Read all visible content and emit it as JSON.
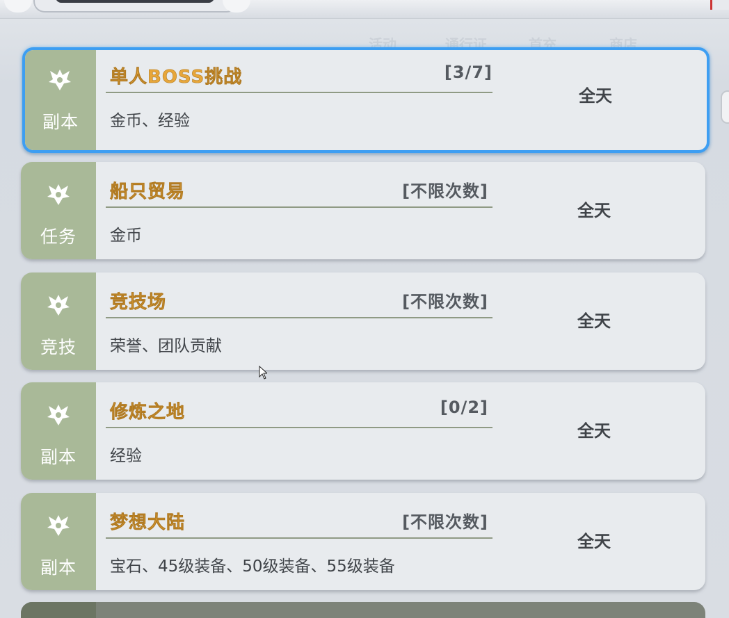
{
  "background_tabs": [
    "活动",
    "通行证",
    "首充",
    "商店"
  ],
  "activities": [
    {
      "category": "副本",
      "title": "单人BOSS挑战",
      "count": "[3/7]",
      "rewards": "金币、经验",
      "time": "全天",
      "selected": true
    },
    {
      "category": "任务",
      "title": "船只贸易",
      "count": "[不限次数]",
      "rewards": "金币",
      "time": "全天",
      "selected": false
    },
    {
      "category": "竞技",
      "title": "竞技场",
      "count": "[不限次数]",
      "rewards": "荣誉、团队贡献",
      "time": "全天",
      "selected": false
    },
    {
      "category": "副本",
      "title": "修炼之地",
      "count": "[0/2]",
      "rewards": "经验",
      "time": "全天",
      "selected": false
    },
    {
      "category": "副本",
      "title": "梦想大陆",
      "count": "[不限次数]",
      "rewards": "宝石、45级装备、50级装备、55级装备",
      "time": "全天",
      "selected": false
    }
  ],
  "colors": {
    "side_panel": "#a9b998",
    "title": "#e7a63a",
    "selected_border": "#3d9ef2",
    "card_bg": "#e8ebee"
  },
  "icons": {
    "category_emblem": "winged-crest-icon",
    "cursor": "mouse-pointer-icon"
  }
}
